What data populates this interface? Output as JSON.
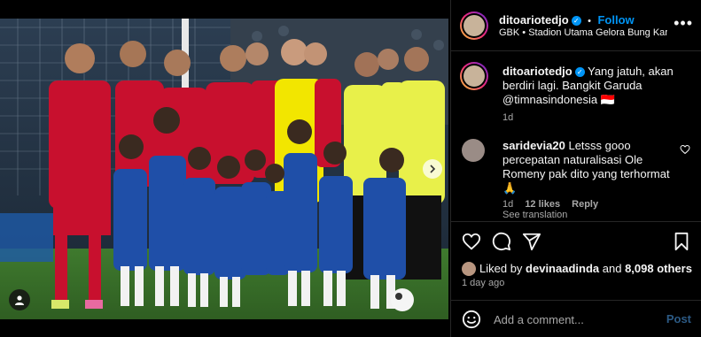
{
  "post": {
    "username": "ditoariotedjo",
    "follow_label": "Follow",
    "follow_separator": "•",
    "location": "GBK • Stadion Utama Gelora Bung Karno",
    "more_label": "•••"
  },
  "caption": {
    "username": "ditoariotedjo",
    "text": "Yang jatuh, akan berdiri lagi. Bangkit Garuda @timnasindonesia 🇮🇩",
    "age": "1d"
  },
  "comments": [
    {
      "username": "saridevia20",
      "text": "Letsss gooo percepatan naturalisasi Ole Romeny pak dito yang terhormat 🙏",
      "age": "1d",
      "likes": "12 likes",
      "reply_label": "Reply",
      "see_translation": "See translation"
    }
  ],
  "likes": {
    "prefix": "Liked by",
    "user": "devinaadinda",
    "joiner": "and",
    "others": "8,098 others"
  },
  "time_ago": "1 day ago",
  "composer": {
    "placeholder": "Add a comment...",
    "post_label": "Post"
  },
  "colors": {
    "accent": "#0095f6",
    "jersey_red": "#c8102e",
    "kids_blue": "#1f4fa8",
    "referee_yellow": "#f2e600"
  },
  "icons": [
    "heart-icon",
    "comment-icon",
    "share-icon",
    "bookmark-icon",
    "smile-icon",
    "chevron-right-icon",
    "user-tag-icon",
    "verified-icon"
  ]
}
